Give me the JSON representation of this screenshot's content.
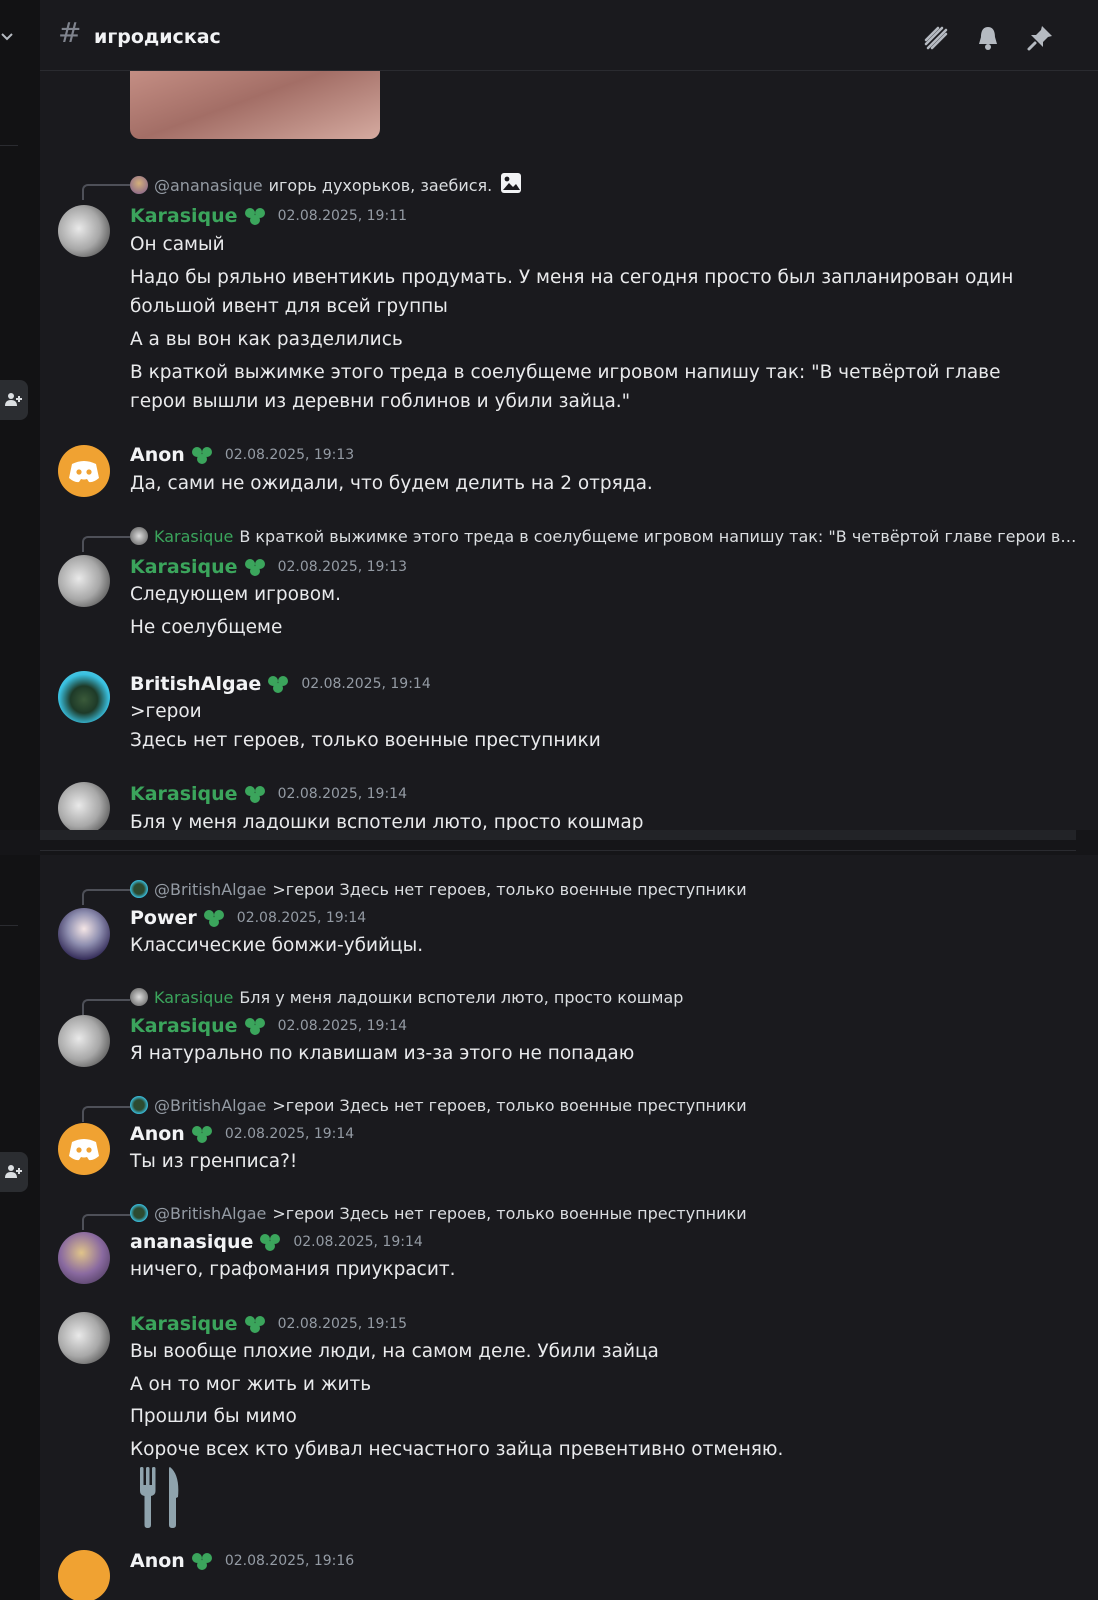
{
  "channel": {
    "name": "игродискас"
  },
  "top_messages": [
    {
      "reply": {
        "mention": "@ananasique",
        "text": "игорь духорьков, заебися."
      },
      "author": "Karasique",
      "time": "02.08.2025, 19:11",
      "lines": [
        "Он самый",
        "Надо бы ряльно ивентикиь продумать. У меня на сегодня просто был запланирован один большой ивент для всей группы",
        "А а вы вон как разделились",
        "В краткой выжимке этого треда в соелубщеме игровом напишу так: \"В четвёртой главе герои вышли из деревни гоблинов и убили зайца.\""
      ]
    },
    {
      "author": "Anon",
      "time": "02.08.2025, 19:13",
      "lines": [
        "Да, сами не ожидали, что будем делить на 2 отряда."
      ]
    },
    {
      "reply": {
        "mention": "Karasique",
        "text": "В краткой выжимке этого треда в соелубщеме игровом напишу так: \"В четвёртой главе герои вышли из..."
      },
      "author": "Karasique",
      "time": "02.08.2025, 19:13",
      "lines": [
        "Следующем игровом.",
        "Не соелубщеме"
      ]
    },
    {
      "author": "BritishAlgae",
      "time": "02.08.2025, 19:14",
      "lines": [
        ">герои",
        "Здесь нет героев, только военные преступники"
      ]
    },
    {
      "author": "Karasique",
      "time": "02.08.2025, 19:14",
      "lines": [
        "Бля у меня ладошки вспотели люто, просто кошмар"
      ]
    }
  ],
  "bottom_messages": [
    {
      "reply": {
        "mention": "@BritishAlgae",
        "text": ">герои Здесь нет героев, только военные преступники"
      },
      "author": "Power",
      "time": "02.08.2025, 19:14",
      "lines": [
        "Классические бомжи-убийцы."
      ]
    },
    {
      "reply": {
        "mention": "Karasique",
        "text": "Бля у меня ладошки вспотели люто, просто кошмар"
      },
      "author": "Karasique",
      "time": "02.08.2025, 19:14",
      "lines": [
        "Я натурально по клавишам из-за этого не попадаю"
      ]
    },
    {
      "reply": {
        "mention": "@BritishAlgae",
        "text": ">герои Здесь нет героев, только военные преступники"
      },
      "author": "Anon",
      "time": "02.08.2025, 19:14",
      "lines": [
        "Ты из гренписа?!"
      ]
    },
    {
      "reply": {
        "mention": "@BritishAlgae",
        "text": ">герои Здесь нет героев, только военные преступники"
      },
      "author": "ananasique",
      "time": "02.08.2025, 19:14",
      "lines": [
        "ничего, графомания приукрасит."
      ]
    },
    {
      "author": "Karasique",
      "time": "02.08.2025, 19:15",
      "lines": [
        "Вы вообще плохие люди, на самом деле. Убили зайца",
        "А он то мог жить и жить",
        "Прошли бы мимо",
        "Короче всех кто убивал несчастного зайца превентивно отменяю."
      ]
    },
    {
      "author": "Anon",
      "time": "02.08.2025, 19:16",
      "lines": []
    }
  ],
  "colors": {
    "accent_green": "#3ba55c",
    "discord_orange": "#f0a232",
    "bg": "#1a1a1e"
  },
  "icons": [
    "threads-icon",
    "bell-icon",
    "pin-icon",
    "image-icon",
    "add-friends-icon",
    "fork-knife-emoji"
  ]
}
